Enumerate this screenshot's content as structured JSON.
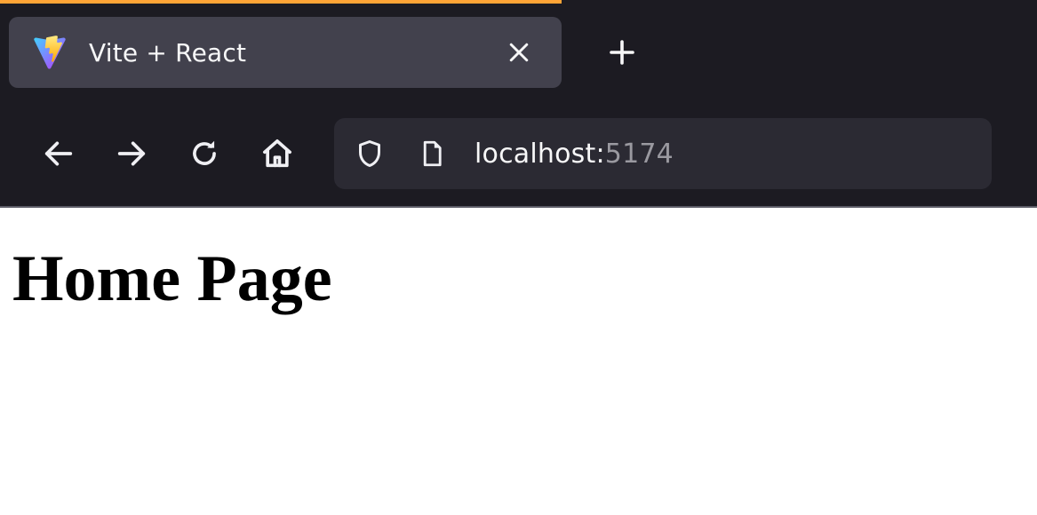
{
  "tab": {
    "title": "Vite + React",
    "favicon_name": "vite-icon"
  },
  "navbar": {
    "back_icon": "arrow-left-icon",
    "forward_icon": "arrow-right-icon",
    "reload_icon": "reload-icon",
    "home_icon": "home-icon"
  },
  "urlbar": {
    "shield_icon": "shield-icon",
    "site_icon": "document-icon",
    "host": "localhost:",
    "port": "5174"
  },
  "page": {
    "heading": "Home Page"
  }
}
